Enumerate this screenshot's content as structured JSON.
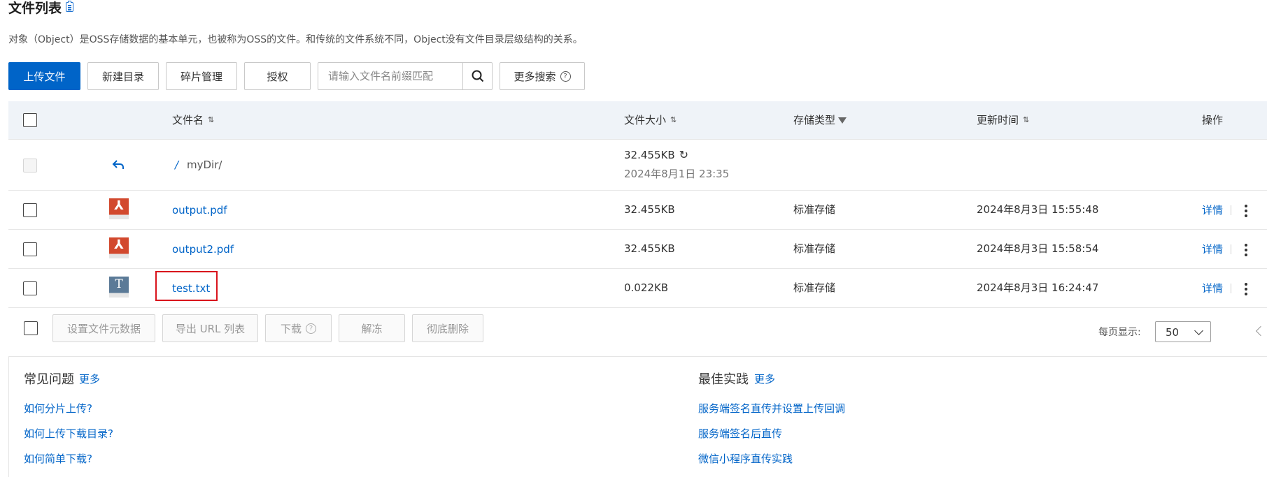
{
  "page": {
    "title": "文件列表",
    "description": "对象（Object）是OSS存储数据的基本单元，也被称为OSS的文件。和传统的文件系统不同，Object没有文件目录层级结构的关系。"
  },
  "toolbar": {
    "upload_label": "上传文件",
    "new_dir_label": "新建目录",
    "fragment_label": "碎片管理",
    "auth_label": "授权",
    "search_placeholder": "请输入文件名前缀匹配",
    "more_search_label": "更多搜索"
  },
  "table": {
    "columns": {
      "name": "文件名",
      "size": "文件大小",
      "storage": "存储类型",
      "updated": "更新时间",
      "actions": "操作"
    },
    "parent_row": {
      "slash": "/",
      "dir": "myDir/",
      "size": "32.455KB",
      "time": "2024年8月1日 23:35"
    },
    "rows": [
      {
        "name": "output.pdf",
        "size": "32.455KB",
        "storage": "标准存储",
        "updated": "2024年8月3日 15:55:48",
        "detail": "详情",
        "icon": "pdf-file-icon"
      },
      {
        "name": "output2.pdf",
        "size": "32.455KB",
        "storage": "标准存储",
        "updated": "2024年8月3日 15:58:54",
        "detail": "详情",
        "icon": "pdf-file-icon"
      },
      {
        "name": "test.txt",
        "size": "0.022KB",
        "storage": "标准存储",
        "updated": "2024年8月3日 16:24:47",
        "detail": "详情",
        "icon": "text-file-icon"
      }
    ]
  },
  "bulk_actions": {
    "set_meta": "设置文件元数据",
    "export_urls": "导出 URL 列表",
    "download": "下载",
    "unfreeze": "解冻",
    "delete": "彻底删除"
  },
  "pagination": {
    "per_page_label": "每页显示:",
    "per_page_value": "50"
  },
  "faq": {
    "title": "常见问题",
    "more": "更多",
    "links": [
      "如何分片上传?",
      "如何上传下载目录?",
      "如何简单下载?"
    ]
  },
  "best_practice": {
    "title": "最佳实践",
    "more": "更多",
    "links": [
      "服务端签名直传并设置上传回调",
      "服务端签名后直传",
      "微信小程序直传实践"
    ]
  },
  "colors": {
    "primary": "#0064c8",
    "highlight": "#d9131c",
    "header_bg": "#eff3f8"
  }
}
